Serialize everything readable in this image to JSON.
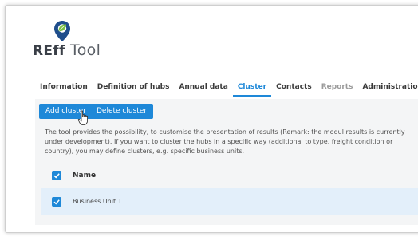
{
  "app": {
    "logo_reff": "REff",
    "logo_tool": "Tool",
    "accent_color": "#1e88d8",
    "logo_leaf_color": "#7cc144",
    "logo_pin_color": "#1f4e8c"
  },
  "tabs": [
    {
      "label": "Information",
      "state": "normal"
    },
    {
      "label": "Definition of hubs",
      "state": "normal"
    },
    {
      "label": "Annual data",
      "state": "normal"
    },
    {
      "label": "Cluster",
      "state": "active"
    },
    {
      "label": "Contacts",
      "state": "normal"
    },
    {
      "label": "Reports",
      "state": "disabled"
    },
    {
      "label": "Administration",
      "state": "normal"
    }
  ],
  "toolbar": {
    "add_label": "Add cluster",
    "delete_label": "Delete cluster"
  },
  "description": "The tool provides the possibility, to customise the presentation of results (Remark: the modul results is currently under development). If you want to cluster the hubs in a specific way (additional to type, freight condition or country), you may define clusters, e.g. specific business units.",
  "table": {
    "header": "Name",
    "header_checked": true,
    "rows": [
      {
        "name": "Business Unit 1",
        "checked": true
      }
    ]
  },
  "icons": {
    "checkbox": "check-icon",
    "cursor": "hand-pointer-icon",
    "logo": "map-pin-leaf-icon"
  }
}
